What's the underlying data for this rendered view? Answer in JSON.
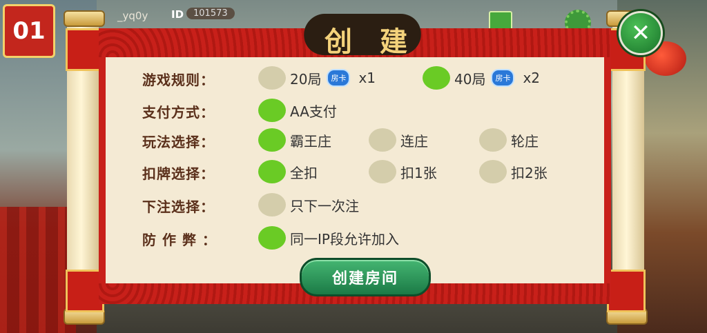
{
  "topbar": {
    "logo_text": "01",
    "user_name": "_yq0y",
    "id_label": "ID",
    "id_value": "101573"
  },
  "dialog": {
    "title": "创建",
    "close_icon": "close-icon",
    "rows": [
      {
        "label": "游戏规则：",
        "options": [
          {
            "text": "20局",
            "badge": "房卡",
            "suffix": "x1",
            "selected": false
          },
          {
            "text": "40局",
            "badge": "房卡",
            "suffix": "x2",
            "selected": true
          }
        ]
      },
      {
        "label": "支付方式：",
        "options": [
          {
            "text": "AA支付",
            "selected": true
          }
        ]
      },
      {
        "label": "玩法选择：",
        "options": [
          {
            "text": "霸王庄",
            "selected": true
          },
          {
            "text": "连庄",
            "selected": false
          },
          {
            "text": "轮庄",
            "selected": false
          }
        ]
      },
      {
        "label": "扣牌选择：",
        "options": [
          {
            "text": "全扣",
            "selected": true
          },
          {
            "text": "扣1张",
            "selected": false
          },
          {
            "text": "扣2张",
            "selected": false
          }
        ]
      },
      {
        "label": "下注选择：",
        "options": [
          {
            "text": "只下一次注",
            "selected": false
          }
        ]
      },
      {
        "label": "防 作 弊 ：",
        "options": [
          {
            "text": "同一IP段允许加入",
            "selected": true
          }
        ]
      }
    ],
    "create_button_label": "创建房间"
  },
  "colors": {
    "selected": "#6acb25",
    "unselected": "#d4cdab",
    "scroll_red": "#c8201a",
    "paper": "#f4ead4",
    "button_green": "#1b7a46"
  }
}
